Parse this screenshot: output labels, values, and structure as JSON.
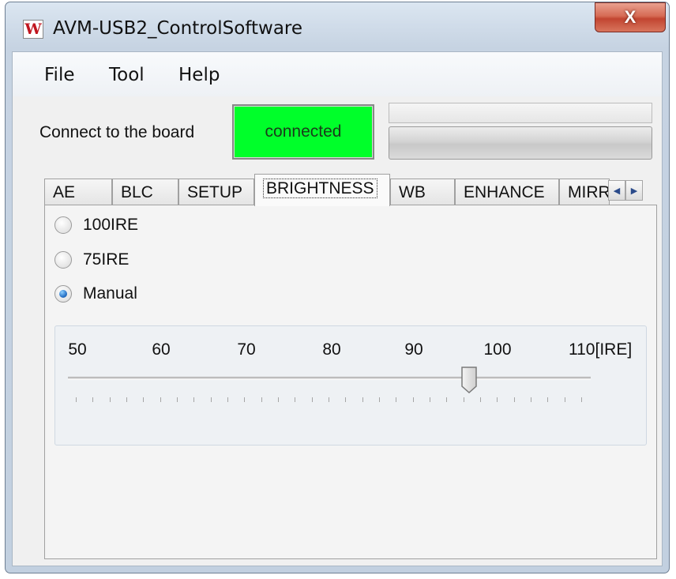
{
  "window": {
    "title": "AVM-USB2_ControlSoftware",
    "app_icon_glyph": "W",
    "close_glyph": "X"
  },
  "menu": {
    "items": [
      "File",
      "Tool",
      "Help"
    ]
  },
  "connection": {
    "label": "Connect to the board",
    "status": "connected",
    "status_color": "#00ff2a"
  },
  "tabs": {
    "items": [
      "AE",
      "BLC",
      "SETUP",
      "BRIGHTNESS",
      "WB",
      "ENHANCE",
      "MIRR"
    ],
    "active": "BRIGHTNESS",
    "scroll_left": "◀",
    "scroll_right": "▶"
  },
  "brightness": {
    "options": [
      {
        "label": "100IRE",
        "selected": false
      },
      {
        "label": "75IRE",
        "selected": false
      },
      {
        "label": "Manual",
        "selected": true
      }
    ],
    "slider": {
      "scale_labels": [
        "50",
        "60",
        "70",
        "80",
        "90",
        "100",
        "110[IRE]"
      ],
      "min": 50,
      "max": 110,
      "value": 96,
      "tick_count": 31
    }
  }
}
